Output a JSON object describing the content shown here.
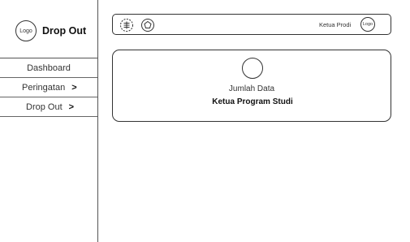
{
  "sidebar": {
    "logo_text": "Logo",
    "brand_title": "Drop Out",
    "items": [
      {
        "label": "Dashboard"
      },
      {
        "label": "Peringatan",
        "chevron": ">"
      },
      {
        "label": "Drop Out",
        "chevron": ">"
      }
    ]
  },
  "topbar": {
    "menu_icon": "menu-icon",
    "pentagon_icon": "pentagon-icon",
    "role_label": "Ketua Prodi",
    "logo_text": "Logo"
  },
  "card": {
    "label": "Jumlah Data",
    "value": "Ketua Program Studi"
  }
}
